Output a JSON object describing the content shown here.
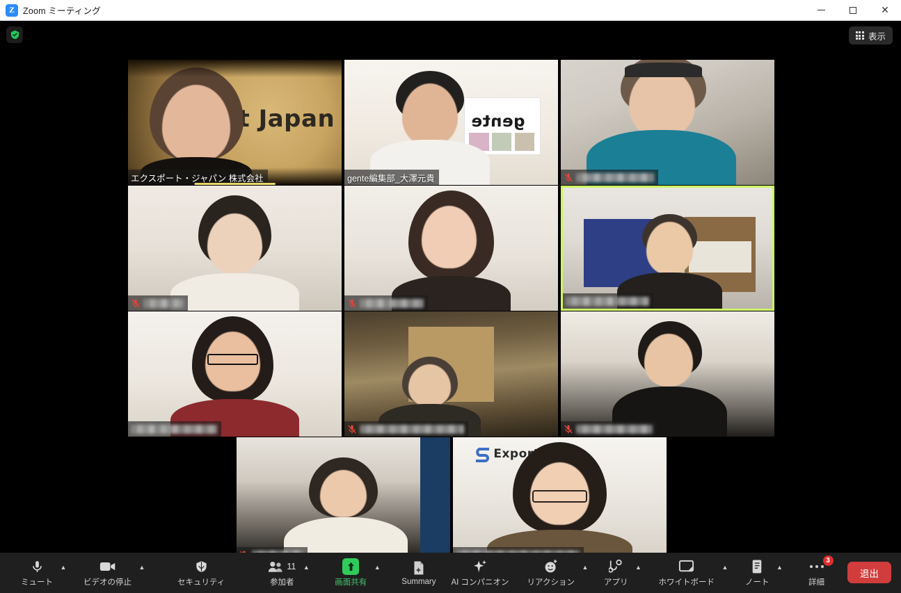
{
  "window": {
    "title": "Zoom ミーティング",
    "app_icon": "zoom-logo-icon",
    "minimize_label": "",
    "maximize_label": "",
    "close_label": "✕"
  },
  "stage": {
    "encryption_badge_icon": "shield-check-icon",
    "view_button": {
      "label": "表示",
      "icon": "grid-icon"
    }
  },
  "participants": [
    {
      "id": 1,
      "name": "エクスポート・ジャパン 株式会社",
      "name_visible": true,
      "muted": false,
      "speaking": true,
      "background_text": "rt Japan"
    },
    {
      "id": 2,
      "name": "gente編集部_大澤元貴",
      "name_visible": true,
      "muted": false,
      "speaking": false,
      "background_text": "gente"
    },
    {
      "id": 3,
      "name": "",
      "name_visible": false,
      "muted": true,
      "speaking": false,
      "background_text": ""
    },
    {
      "id": 4,
      "name": "",
      "name_visible": false,
      "muted": true,
      "speaking": false,
      "background_text": ""
    },
    {
      "id": 5,
      "name": "",
      "name_visible": false,
      "muted": true,
      "speaking": false,
      "background_text": ""
    },
    {
      "id": 6,
      "name": "",
      "name_visible": false,
      "muted": false,
      "speaking": true,
      "background_text": ""
    },
    {
      "id": 7,
      "name": "",
      "name_visible": false,
      "muted": false,
      "speaking": false,
      "background_text": ""
    },
    {
      "id": 8,
      "name": "",
      "name_visible": false,
      "muted": true,
      "speaking": false,
      "background_text": ""
    },
    {
      "id": 9,
      "name": "",
      "name_visible": false,
      "muted": true,
      "speaking": false,
      "background_text": ""
    },
    {
      "id": 10,
      "name": "",
      "name_visible": false,
      "muted": true,
      "speaking": false,
      "background_text": ""
    },
    {
      "id": 11,
      "name": "",
      "name_visible": false,
      "muted": false,
      "speaking": false,
      "background_text": "Export"
    }
  ],
  "toolbar": {
    "mute": {
      "label": "ミュート",
      "icon": "microphone-icon",
      "has_caret": true
    },
    "video": {
      "label": "ビデオの停止",
      "icon": "camera-icon",
      "has_caret": true
    },
    "security": {
      "label": "セキュリティ",
      "icon": "shield-icon",
      "has_caret": false
    },
    "participants": {
      "label": "参加者",
      "icon": "people-icon",
      "count": "11",
      "has_caret": true
    },
    "share": {
      "label": "画面共有",
      "icon": "share-screen-up-arrow-icon",
      "has_caret": true
    },
    "summary": {
      "label": "Summary",
      "icon": "summary-doc-sparkle-icon",
      "has_caret": false
    },
    "ai_companion": {
      "label": "AI コンパニオン",
      "icon": "sparkle-icon",
      "has_caret": false
    },
    "reactions": {
      "label": "リアクション",
      "icon": "smiley-plus-icon",
      "has_caret": true
    },
    "apps": {
      "label": "アプリ",
      "icon": "apps-icon",
      "has_caret": true
    },
    "whiteboard": {
      "label": "ホワイトボード",
      "icon": "whiteboard-icon",
      "has_caret": true
    },
    "notes": {
      "label": "ノート",
      "icon": "notes-icon",
      "has_caret": true
    },
    "more": {
      "label": "詳細",
      "icon": "ellipsis-icon",
      "badge": "3",
      "has_caret": false
    },
    "leave": {
      "label": "退出"
    }
  },
  "colors": {
    "accent_green": "#31cb5a",
    "share_label_green": "#41c36a",
    "speaking_border": "#cdf564",
    "leave_red": "#d13d3d",
    "badge_red": "#e02d2d",
    "toolbar_bg": "#1f1f1f",
    "stage_bg": "#000000",
    "titlebar_bg": "#ffffff"
  }
}
